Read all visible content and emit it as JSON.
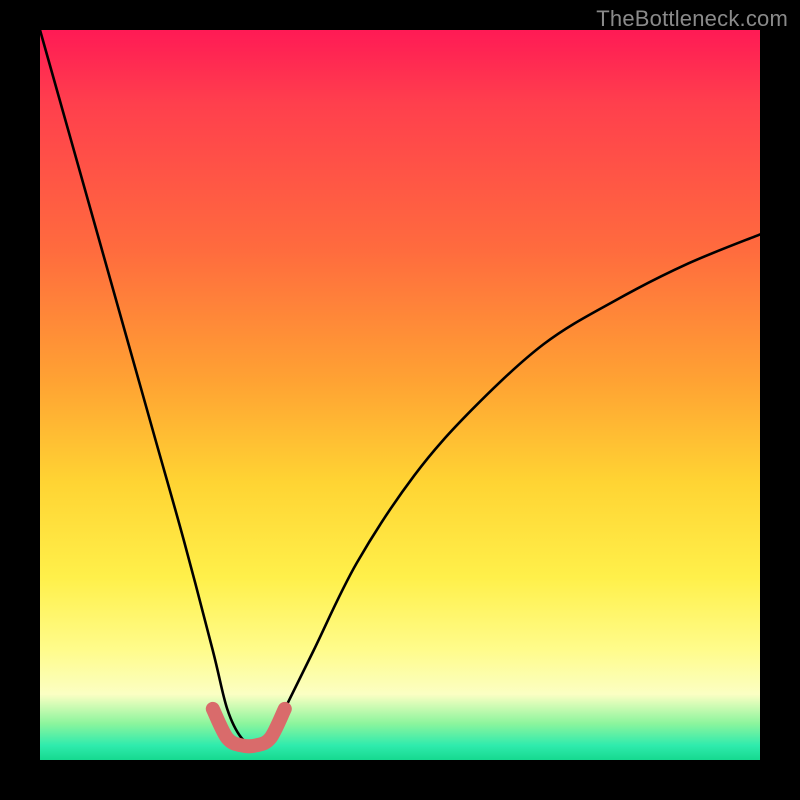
{
  "attribution": "TheBottleneck.com",
  "colors": {
    "frame": "#000000",
    "curve": "#000000",
    "valley_highlight": "#d96b6b",
    "gradient_top": "#ff1a55",
    "gradient_bottom": "#16d98f"
  },
  "chart_data": {
    "type": "line",
    "title": "",
    "xlabel": "",
    "ylabel": "",
    "xlim": [
      0,
      100
    ],
    "ylim": [
      0,
      100
    ],
    "series": [
      {
        "name": "bottleneck-curve",
        "x": [
          0,
          4,
          8,
          12,
          16,
          20,
          24,
          26,
          28,
          30,
          32,
          34,
          38,
          44,
          52,
          60,
          70,
          80,
          90,
          100
        ],
        "y": [
          100,
          86,
          72,
          58,
          44,
          30,
          15,
          7,
          3,
          2,
          3,
          7,
          15,
          27,
          39,
          48,
          57,
          63,
          68,
          72
        ]
      },
      {
        "name": "valley-highlight",
        "x": [
          24,
          26,
          28,
          30,
          32,
          34
        ],
        "y": [
          7,
          3,
          2,
          2,
          3,
          7
        ]
      }
    ],
    "grid": false
  }
}
